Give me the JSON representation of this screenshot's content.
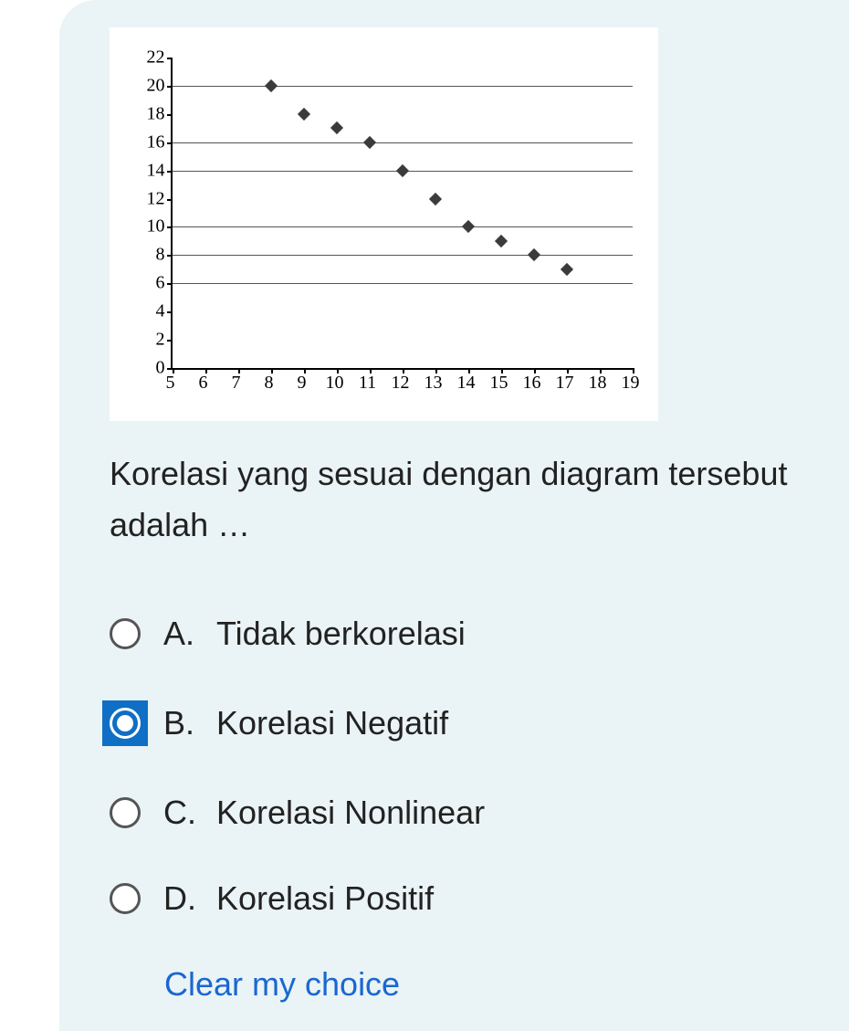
{
  "chart_data": {
    "type": "scatter",
    "x": [
      8,
      9,
      10,
      11,
      12,
      13,
      14,
      15,
      16,
      17
    ],
    "y": [
      20,
      18,
      17,
      16,
      14,
      12,
      10,
      9,
      8,
      7
    ],
    "x_ticks": [
      5,
      6,
      7,
      8,
      9,
      10,
      11,
      12,
      13,
      14,
      15,
      16,
      17,
      18,
      19
    ],
    "y_ticks": [
      0,
      2,
      4,
      6,
      8,
      10,
      12,
      14,
      16,
      18,
      20,
      22
    ],
    "xlim": [
      5,
      19
    ],
    "ylim": [
      0,
      22
    ],
    "gridlines_y": [
      6,
      8,
      10,
      14,
      16,
      20
    ],
    "xlabel": "",
    "ylabel": "",
    "title": ""
  },
  "question": {
    "text": "Korelasi yang sesuai dengan diagram tersebut adalah …"
  },
  "options": [
    {
      "letter": "A.",
      "text": "Tidak berkorelasi",
      "selected": false
    },
    {
      "letter": "B.",
      "text": "Korelasi Negatif",
      "selected": true
    },
    {
      "letter": "C.",
      "text": "Korelasi Nonlinear",
      "selected": false
    },
    {
      "letter": "D.",
      "text": "Korelasi Positif",
      "selected": false
    }
  ],
  "clear_choice": "Clear my choice"
}
